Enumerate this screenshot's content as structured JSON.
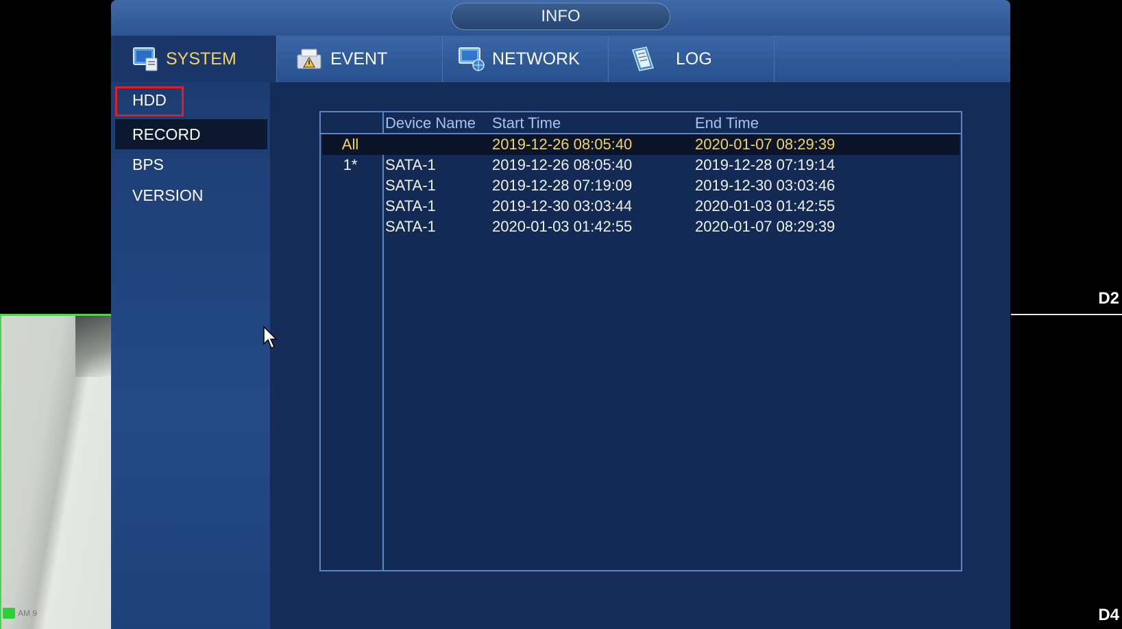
{
  "window": {
    "title": "INFO"
  },
  "tabs": [
    {
      "label": "SYSTEM",
      "icon": "monitor-icon",
      "active": true
    },
    {
      "label": "EVENT",
      "icon": "warning-printer-icon",
      "active": false
    },
    {
      "label": "NETWORK",
      "icon": "network-globe-icon",
      "active": false
    },
    {
      "label": "LOG",
      "icon": "log-book-icon",
      "active": false
    }
  ],
  "sidebar": {
    "items": [
      {
        "label": "HDD",
        "highlighted": true
      },
      {
        "label": "RECORD",
        "selected": true
      },
      {
        "label": "BPS"
      },
      {
        "label": "VERSION"
      }
    ]
  },
  "table": {
    "headers": {
      "index": "",
      "device": "Device Name",
      "start": "Start Time",
      "end": "End Time"
    },
    "rows": [
      {
        "index": "All",
        "device": "",
        "start": "2019-12-26 08:05:40",
        "end": "2020-01-07 08:29:39"
      },
      {
        "index": "1*",
        "device": "SATA-1",
        "start": "2019-12-26 08:05:40",
        "end": "2019-12-28 07:19:14"
      },
      {
        "index": "",
        "device": "SATA-1",
        "start": "2019-12-28 07:19:09",
        "end": "2019-12-30 03:03:46"
      },
      {
        "index": "",
        "device": "SATA-1",
        "start": "2019-12-30 03:03:44",
        "end": "2020-01-03 01:42:55"
      },
      {
        "index": "",
        "device": "SATA-1",
        "start": "2020-01-03 01:42:55",
        "end": "2020-01-07 08:29:39"
      }
    ]
  },
  "background": {
    "camera_labels": {
      "top_right": "D2",
      "bottom_right": "D4"
    },
    "status_text": "AM 9"
  },
  "colors": {
    "accent_active_tab": "#f2d65b",
    "highlight_border": "#e01e24",
    "panel_bg": "#162c58",
    "grid_line": "#5d84c4"
  }
}
